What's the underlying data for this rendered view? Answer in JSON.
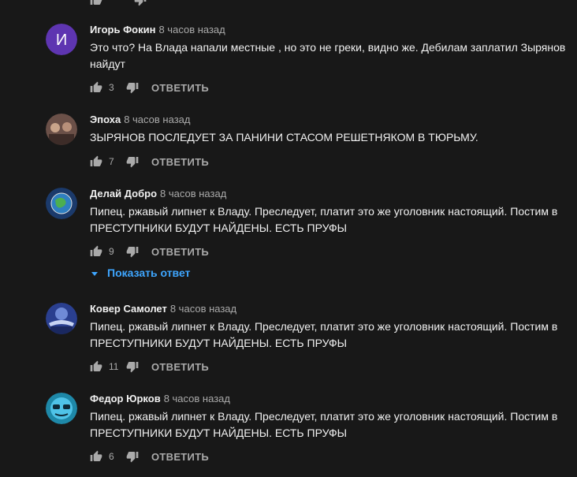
{
  "top_partial": {
    "like_count": ""
  },
  "comments": [
    {
      "author": "Игорь Фокин",
      "time": "8 часов назад",
      "avatar_letter": "И",
      "avatar_color": "#5e35b1",
      "lines": [
        "Это что? На Влада напали местные , но это не греки, видно же. Дебилам заплатил Зырянов",
        "найдут"
      ],
      "likes": "3",
      "reply_label": "ОТВЕТИТЬ"
    },
    {
      "author": "Эпоха",
      "time": "8 часов назад",
      "avatar_letter": "",
      "avatar_color": "#6b5048",
      "lines": [
        "ЗЫРЯНОВ ПОСЛЕДУЕТ ЗА ПАНИНИ СТАСОМ РЕШЕТНЯКОМ В ТЮРЬМУ."
      ],
      "likes": "7",
      "reply_label": "ОТВЕТИТЬ"
    },
    {
      "author": "Делай Добро",
      "time": "8 часов назад",
      "avatar_letter": "",
      "avatar_color": "#1b3a6b",
      "lines": [
        "Пипец. ржавый липнет к Владу. Преследует, платит это же уголовник настоящий. Постим в",
        "ПРЕСТУПНИКИ БУДУТ НАЙДЕНЫ. ЕСТЬ ПРУФЫ"
      ],
      "likes": "9",
      "reply_label": "ОТВЕТИТЬ",
      "show_replies": "Показать ответ"
    },
    {
      "author": "Ковер Самолет",
      "time": "8 часов назад",
      "avatar_letter": "",
      "avatar_color": "#2a3f8f",
      "lines": [
        "Пипец. ржавый липнет к Владу. Преследует, платит это же уголовник настоящий. Постим в",
        "ПРЕСТУПНИКИ БУДУТ НАЙДЕНЫ. ЕСТЬ ПРУФЫ"
      ],
      "likes": "11",
      "reply_label": "ОТВЕТИТЬ"
    },
    {
      "author": "Федор Юрков",
      "time": "8 часов назад",
      "avatar_letter": "",
      "avatar_color": "#1e88a8",
      "lines": [
        "Пипец. ржавый липнет к Владу. Преследует, платит это же уголовник настоящий. Постим в",
        "ПРЕСТУПНИКИ БУДУТ НАЙДЕНЫ. ЕСТЬ ПРУФЫ"
      ],
      "likes": "6",
      "reply_label": "ОТВЕТИТЬ"
    }
  ],
  "icons": {
    "like": "thumb-up-icon",
    "dislike": "thumb-down-icon",
    "expand": "caret-down-icon"
  },
  "colors": {
    "background": "#181818",
    "text": "#f1f1f1",
    "secondary": "#aaaaaa",
    "link": "#3ea6ff"
  }
}
